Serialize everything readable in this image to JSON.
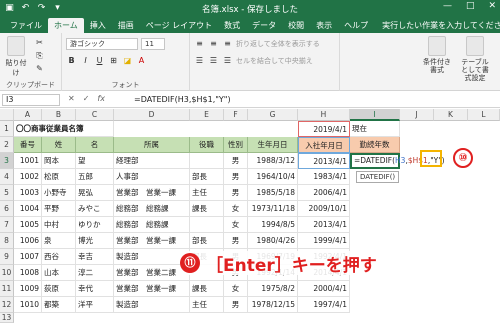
{
  "window": {
    "title": "名簿.xlsx  -  保存しました",
    "controls": [
      "—",
      "□",
      "✕"
    ]
  },
  "ribbon": {
    "tabs": [
      "ファイル",
      "ホーム",
      "挿入",
      "描画",
      "ページ レイアウト",
      "数式",
      "データ",
      "校閲",
      "表示",
      "ヘルプ"
    ],
    "active_tab": "ホーム",
    "tell_me": "実行したい作業を入力してください",
    "clipboard_label": "クリップボード",
    "font_label": "フォント",
    "paste_label": "貼り付け",
    "font_name": "游ゴシック",
    "font_size": "11",
    "wrap_text": "折り返して全体を表示する",
    "merge_center": "セルを結合して中央揃え",
    "conditional_format": "条件付き書式",
    "table_format": "テーブルとして書式設定"
  },
  "formula_bar": {
    "name_box": "I3",
    "formula": "=DATEDIF(H3,$H$1,\"Y\")"
  },
  "sheet": {
    "columns": [
      "A",
      "B",
      "C",
      "D",
      "E",
      "F",
      "G",
      "H",
      "I",
      "J",
      "K",
      "L"
    ],
    "rows": [
      "1",
      "2",
      "3",
      "4",
      "5",
      "6",
      "7",
      "8",
      "9",
      "10",
      "11",
      "12",
      "13"
    ],
    "selected_column": "I",
    "selected_row": "3",
    "title_cell": "〇〇商事従業員名簿",
    "h1_date": "2019/4/1",
    "i1_label": "現在",
    "headers": [
      "番号",
      "姓",
      "名",
      "所属",
      "役職",
      "性別",
      "生年月日",
      "入社年月日",
      "勤続年数"
    ],
    "records": [
      [
        "1001",
        "岡本",
        "望",
        "経理部",
        "",
        "男",
        "1988/3/12",
        "2013/4/1"
      ],
      [
        "1002",
        "松原",
        "五郎",
        "人事部",
        "部長",
        "男",
        "1964/10/4",
        "1983/4/1"
      ],
      [
        "1003",
        "小野寺",
        "晃弘",
        "営業部　営業一課",
        "主任",
        "男",
        "1985/5/18",
        "2006/4/1"
      ],
      [
        "1004",
        "平野",
        "みやこ",
        "総務部　総務課",
        "課長",
        "女",
        "1973/11/18",
        "2009/10/1"
      ],
      [
        "1005",
        "中村",
        "ゆりか",
        "総務部　総務課",
        "",
        "女",
        "1994/8/5",
        "2013/4/1"
      ],
      [
        "1006",
        "泉",
        "博光",
        "営業部　営業一課",
        "部長",
        "男",
        "1980/4/26",
        "1999/4/1"
      ],
      [
        "1007",
        "西谷",
        "幸吉",
        "製造部",
        "部長",
        "男",
        "1969/7/19",
        "1992/4/1"
      ],
      [
        "1008",
        "山本",
        "淳二",
        "営業部　営業二課",
        "",
        "男",
        "1992/1/14",
        "2014/4/1"
      ],
      [
        "1009",
        "荻原",
        "幸代",
        "営業部　営業一課",
        "課長",
        "女",
        "1975/8/2",
        "2000/4/1"
      ],
      [
        "1010",
        "都築",
        "洋平",
        "製造部",
        "主任",
        "男",
        "1978/12/15",
        "1997/4/1"
      ]
    ],
    "i3_parts": {
      "prefix": "=DATEDIF(",
      "ref1": "H3",
      "comma": ",",
      "ref2": "$H$1",
      "suffix": ",\"Y\")"
    },
    "tooltip": "DATEDIF()"
  },
  "callouts": {
    "step10": "⑩",
    "step11_num": "⑪",
    "step11_text": "［Enter］キーを押す"
  },
  "colors": {
    "excel_green": "#217346",
    "header_green": "#c6e0b4",
    "header_pink": "#f8cbad",
    "callout_red": "#e02020",
    "highlight_yellow": "#f4b400"
  }
}
